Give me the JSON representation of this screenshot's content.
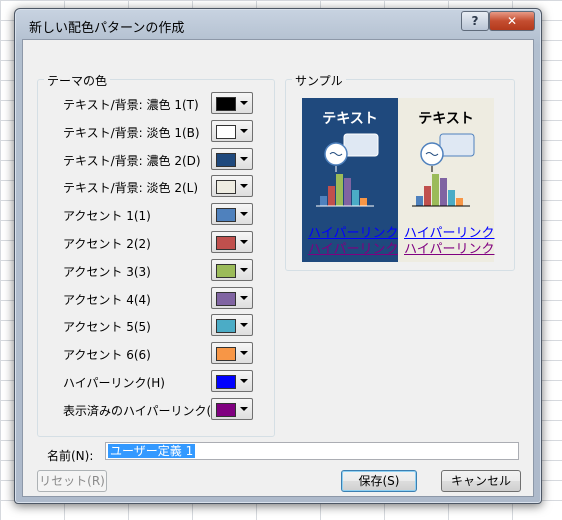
{
  "dialog": {
    "title": "新しい配色パターンの作成",
    "help_label": "?",
    "close_label": "✕"
  },
  "theme_colors": {
    "group_label": "テーマの色",
    "rows": [
      {
        "label": "テキスト/背景: 濃色 1(T)",
        "color": "#000000"
      },
      {
        "label": "テキスト/背景: 淡色 1(B)",
        "color": "#ffffff"
      },
      {
        "label": "テキスト/背景: 濃色 2(D)",
        "color": "#1f497d"
      },
      {
        "label": "テキスト/背景: 淡色 2(L)",
        "color": "#eeece1"
      },
      {
        "label": "アクセント 1(1)",
        "color": "#4f81bd"
      },
      {
        "label": "アクセント 2(2)",
        "color": "#c0504d"
      },
      {
        "label": "アクセント 3(3)",
        "color": "#9bbb59"
      },
      {
        "label": "アクセント 4(4)",
        "color": "#8064a2"
      },
      {
        "label": "アクセント 5(5)",
        "color": "#4bacc6"
      },
      {
        "label": "アクセント 6(6)",
        "color": "#f79646"
      },
      {
        "label": "ハイパーリンク(H)",
        "color": "#0000ff"
      },
      {
        "label": "表示済みのハイパーリンク(F)",
        "color": "#800080"
      }
    ]
  },
  "sample": {
    "group_label": "サンプル",
    "dark": {
      "title": "テキスト",
      "link": "ハイパーリンク",
      "visited_link": "ハイパーリンク"
    },
    "light": {
      "title": "テキスト",
      "link": "ハイパーリンク",
      "visited_link": "ハイパーリンク"
    }
  },
  "name": {
    "label": "名前(N):",
    "value": "ユーザー定義 1"
  },
  "buttons": {
    "reset": "リセット(R)",
    "save": "保存(S)",
    "cancel": "キャンセル"
  }
}
